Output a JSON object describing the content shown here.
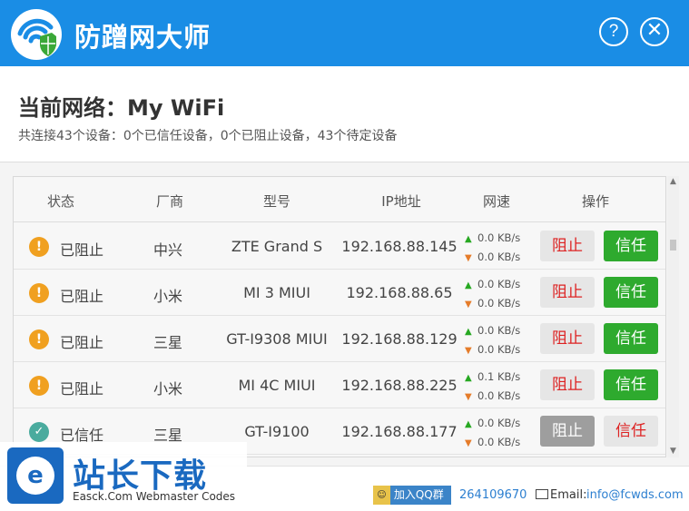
{
  "app": {
    "title": "防蹭网大师",
    "help_label": "?",
    "close_label": "✕"
  },
  "network": {
    "label": "当前网络：",
    "name": "My WiFi",
    "summary": "共连接43个设备：0个已信任设备，0个已阻止设备，43个待定设备"
  },
  "table": {
    "headers": [
      "状态",
      "厂商",
      "型号",
      "IP地址",
      "网速",
      "操作"
    ],
    "rows": [
      {
        "status": "已阻止",
        "status_icon": "warning-icon",
        "vendor": "中兴",
        "model": "ZTE Grand S",
        "ip": "192.168.88.145",
        "up": "0.0 KB/s",
        "down": "0.0 KB/s",
        "block_label": "阻止",
        "trust_label": "信任"
      },
      {
        "status": "已阻止",
        "status_icon": "warning-icon",
        "vendor": "小米",
        "model": "MI 3 MIUI",
        "ip": "192.168.88.65",
        "up": "0.0 KB/s",
        "down": "0.0 KB/s",
        "block_label": "阻止",
        "trust_label": "信任"
      },
      {
        "status": "已阻止",
        "status_icon": "warning-icon",
        "vendor": "三星",
        "model": "GT-I9308 MIUI",
        "ip": "192.168.88.129",
        "up": "0.0 KB/s",
        "down": "0.0 KB/s",
        "block_label": "阻止",
        "trust_label": "信任"
      },
      {
        "status": "已阻止",
        "status_icon": "warning-icon",
        "vendor": "小米",
        "model": "MI 4C MIUI",
        "ip": "192.168.88.225",
        "up": "0.1 KB/s",
        "down": "0.0 KB/s",
        "block_label": "阻止",
        "trust_label": "信任"
      },
      {
        "status": "已信任",
        "status_icon": "check-icon",
        "vendor": "三星",
        "model": "GT-I9100",
        "ip": "192.168.88.177",
        "up": "0.0 KB/s",
        "down": "0.0 KB/s",
        "block_label": "阻止",
        "trust_label": "信任"
      }
    ]
  },
  "footer": {
    "qq_label": "加入QQ群",
    "qq_number": "264109670",
    "email_label": "Email:",
    "email": "info@fcwds.com"
  },
  "watermark": {
    "title": "站长下载",
    "subtitle": "Easck.Com Webmaster Codes"
  },
  "colors": {
    "titlebar": "#1a8de5",
    "trust_button": "#2eaa2e",
    "block_text": "#dd2222",
    "warning": "#f0a020"
  }
}
